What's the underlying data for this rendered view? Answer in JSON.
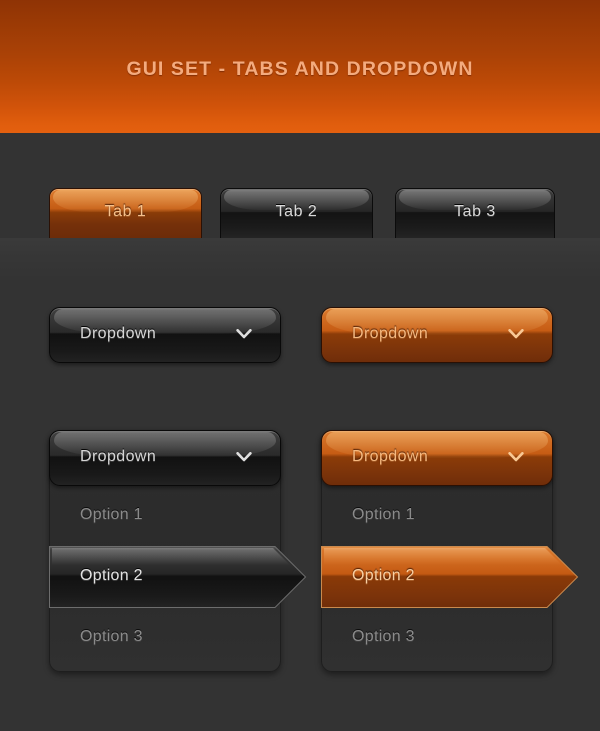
{
  "header": {
    "title": "GUI SET - TABS AND DROPDOWN",
    "title_color": "#f4ab7e",
    "gradient_top": "#8f3305",
    "gradient_bottom": "#e4600f"
  },
  "theme": {
    "background": "#333333",
    "panel_background": "#2e2e2e",
    "accent_orange": "#d9762a",
    "accent_orange_dark": "#702d09",
    "dark_button_top": "#3e3e3e",
    "dark_button_bottom": "#1b1b1b",
    "option_text": "#8b8b8b",
    "dark_label_text": "#d6d6d6",
    "orange_label_text": "#f7b97f"
  },
  "tabs": {
    "items": [
      {
        "label": "Tab 1",
        "state": "active",
        "variant": "orange"
      },
      {
        "label": "Tab 2",
        "state": "inactive",
        "variant": "dark"
      },
      {
        "label": "Tab 3",
        "state": "inactive",
        "variant": "dark"
      }
    ]
  },
  "dropdown_buttons": [
    {
      "label": "Dropdown",
      "variant": "dark",
      "icon": "chevron-down-icon",
      "state": "closed"
    },
    {
      "label": "Dropdown",
      "variant": "orange",
      "icon": "chevron-down-icon",
      "state": "closed"
    }
  ],
  "dropdown_panels": [
    {
      "variant": "dark",
      "trigger_label": "Dropdown",
      "icon": "chevron-down-icon",
      "state": "open",
      "options": [
        {
          "label": "Option 1",
          "selected": false
        },
        {
          "label": "Option 2",
          "selected": true
        },
        {
          "label": "Option 3",
          "selected": false
        }
      ]
    },
    {
      "variant": "orange",
      "trigger_label": "Dropdown",
      "icon": "chevron-down-icon",
      "state": "open",
      "options": [
        {
          "label": "Option 1",
          "selected": false
        },
        {
          "label": "Option 2",
          "selected": true
        },
        {
          "label": "Option 3",
          "selected": false
        }
      ]
    }
  ]
}
